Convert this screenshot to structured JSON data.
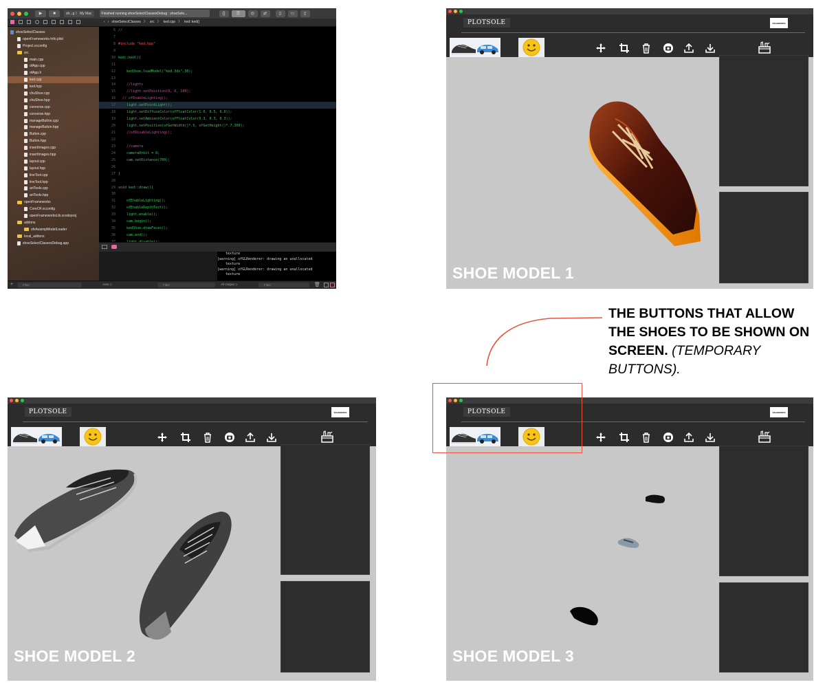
{
  "xcode": {
    "scheme": "sh...g",
    "target": "My Mac",
    "status": "Finished running shoeSelectClassesDebug : shoeSele...",
    "jump_bar": [
      "shoeSelectClasses",
      "src",
      "ked.cpp",
      "ked::ked()"
    ],
    "navigator": [
      {
        "label": "shoeSelectClasses",
        "indent": 0,
        "kind": "project"
      },
      {
        "label": "openFrameworks-Info.plist",
        "indent": 1,
        "kind": "file"
      },
      {
        "label": "Project.xcconfig",
        "indent": 1,
        "kind": "file"
      },
      {
        "label": "src",
        "indent": 1,
        "kind": "folder"
      },
      {
        "label": "main.cpp",
        "indent": 2,
        "kind": "file"
      },
      {
        "label": "ofApp.cpp",
        "indent": 2,
        "kind": "file"
      },
      {
        "label": "ofApp.h",
        "indent": 2,
        "kind": "file"
      },
      {
        "label": "ked.cpp",
        "indent": 2,
        "kind": "file",
        "selected": true
      },
      {
        "label": "ked.hpp",
        "indent": 2,
        "kind": "file"
      },
      {
        "label": "chuShoe.cpp",
        "indent": 2,
        "kind": "file"
      },
      {
        "label": "chuShoe.hpp",
        "indent": 2,
        "kind": "file"
      },
      {
        "label": "converse.cpp",
        "indent": 2,
        "kind": "file"
      },
      {
        "label": "converse.hpp",
        "indent": 2,
        "kind": "file"
      },
      {
        "label": "manageButton.cpp",
        "indent": 2,
        "kind": "file"
      },
      {
        "label": "manageButton.hpp",
        "indent": 2,
        "kind": "file"
      },
      {
        "label": "Button.cpp",
        "indent": 2,
        "kind": "file"
      },
      {
        "label": "Button.hpp",
        "indent": 2,
        "kind": "file"
      },
      {
        "label": "insertImages.cpp",
        "indent": 2,
        "kind": "file"
      },
      {
        "label": "insertImages.hpp",
        "indent": 2,
        "kind": "file"
      },
      {
        "label": "layout.cpp",
        "indent": 2,
        "kind": "file"
      },
      {
        "label": "layout.hpp",
        "indent": 2,
        "kind": "file"
      },
      {
        "label": "lineTool.cpp",
        "indent": 2,
        "kind": "file"
      },
      {
        "label": "lineTool.hpp",
        "indent": 2,
        "kind": "file"
      },
      {
        "label": "artTools.cpp",
        "indent": 2,
        "kind": "file"
      },
      {
        "label": "artTools.hpp",
        "indent": 2,
        "kind": "file"
      },
      {
        "label": "openFrameworks",
        "indent": 1,
        "kind": "folder"
      },
      {
        "label": "CoreOF.xcconfig",
        "indent": 2,
        "kind": "file"
      },
      {
        "label": "openFrameworksLib.xcodeproj",
        "indent": 2,
        "kind": "file"
      },
      {
        "label": "addons",
        "indent": 1,
        "kind": "folder"
      },
      {
        "label": "ofxAssimpModelLoader",
        "indent": 2,
        "kind": "folder"
      },
      {
        "label": "local_addons",
        "indent": 1,
        "kind": "folder"
      },
      {
        "label": "shoeSelectClassesDebug.app",
        "indent": 1,
        "kind": "file"
      }
    ],
    "code": [
      {
        "n": "6",
        "t": "//",
        "c": "#d04aa0"
      },
      {
        "n": "7",
        "t": "",
        "c": "#3ec45d"
      },
      {
        "n": "8",
        "t": "#include \"ked.hpp\"",
        "c": "#e25555"
      },
      {
        "n": "9",
        "t": "",
        "c": "#3ec45d"
      },
      {
        "n": "10",
        "t": "ked::ked(){",
        "c": "#3ec45d"
      },
      {
        "n": "11",
        "t": "",
        "c": "#3ec45d"
      },
      {
        "n": "12",
        "t": "    kedShoe.loadModel(\"ked.3ds\",30);",
        "c": "#3ec45d"
      },
      {
        "n": "13",
        "t": "",
        "c": "#3ec45d"
      },
      {
        "n": "14",
        "t": "    //lights",
        "c": "#d04aa0"
      },
      {
        "n": "15",
        "t": "    //light.setPosition(0, 0, 100);",
        "c": "#d04aa0"
      },
      {
        "n": "16",
        "t": "  // ofEnableLighting();",
        "c": "#d04aa0"
      },
      {
        "n": "17",
        "t": "    light.setPointLight();",
        "c": "#3ec45d",
        "cur": true
      },
      {
        "n": "18",
        "t": "    light.setDiffuseColor(ofFloatColor(1.0, 0.5, 0.0));",
        "c": "#3ec45d"
      },
      {
        "n": "19",
        "t": "    light.setAmbientColor(ofFloatColor(0.3, 0.3, 0.3));",
        "c": "#3ec45d"
      },
      {
        "n": "20",
        "t": "    light.setPosition(ofGetWidth()*.5, ofGetHeight()*.7,300);",
        "c": "#3ec45d"
      },
      {
        "n": "21",
        "t": "    //ofDisableLighting();",
        "c": "#d04aa0"
      },
      {
        "n": "22",
        "t": "",
        "c": "#3ec45d"
      },
      {
        "n": "23",
        "t": "    //camera",
        "c": "#d04aa0"
      },
      {
        "n": "24",
        "t": "    cameraOrbit = 0;",
        "c": "#3ec45d"
      },
      {
        "n": "25",
        "t": "    cam.setDistance(700);",
        "c": "#3ec45d"
      },
      {
        "n": "26",
        "t": "",
        "c": "#3ec45d"
      },
      {
        "n": "27",
        "t": "}",
        "c": "#3ec45d"
      },
      {
        "n": "28",
        "t": "",
        "c": "#3ec45d"
      },
      {
        "n": "29",
        "t": "void ked::draw(){",
        "c": "#3ec45d"
      },
      {
        "n": "30",
        "t": "",
        "c": "#3ec45d"
      },
      {
        "n": "31",
        "t": "    ofEnableLighting();",
        "c": "#3ec45d"
      },
      {
        "n": "32",
        "t": "    ofEnableDepthTest();",
        "c": "#3ec45d"
      },
      {
        "n": "33",
        "t": "    light.enable();",
        "c": "#3ec45d"
      },
      {
        "n": "34",
        "t": "    cam.begin();",
        "c": "#3ec45d"
      },
      {
        "n": "35",
        "t": "    kedShoe.drawFaces();",
        "c": "#3ec45d"
      },
      {
        "n": "36",
        "t": "    cam.end();",
        "c": "#3ec45d"
      },
      {
        "n": "37",
        "t": "    light.disable();",
        "c": "#3ec45d"
      },
      {
        "n": "38",
        "t": "    ofDisableDepthTest();",
        "c": "#3ec45d"
      },
      {
        "n": "39",
        "t": "    ofDisableLighting();",
        "c": "#3ec45d"
      },
      {
        "n": "40",
        "t": "",
        "c": "#3ec45d"
      },
      {
        "n": "41",
        "t": "}",
        "c": "#3ec45d"
      },
      {
        "n": "42",
        "t": "",
        "c": "#3ec45d"
      }
    ],
    "console": [
      "    texture",
      "[warning] ofGLRenderer: drawing an unallocated",
      "    texture",
      "[warning] ofGLRenderer: drawing an unallocated",
      "    texture"
    ],
    "bottom": {
      "auto": "Auto ◇",
      "filter": "Filter",
      "output": "All Output ◇"
    }
  },
  "app": {
    "brand": "PLOTSOLE",
    "mini_logo": "SALEBOOKS",
    "icons": [
      "move-icon",
      "crop-icon",
      "trash-icon",
      "camera-icon",
      "upload-icon",
      "download-icon",
      "toolbox-icon"
    ]
  },
  "labels": {
    "model1": "SHOE MODEL 1",
    "model2": "SHOE MODEL 2",
    "model3": "SHOE MODEL 3"
  },
  "annotation": {
    "bold": " THE BUTTONS THAT ALLOW THE SHOES TO BE SHOWN ON SCREEN.",
    "italic": "(TEMPORARY BUTTONS)."
  },
  "colors": {
    "accent_line": "#d0337a",
    "highlight": "#e8553d",
    "code_green": "#3ec45d",
    "comment_pink": "#d04aa0"
  }
}
